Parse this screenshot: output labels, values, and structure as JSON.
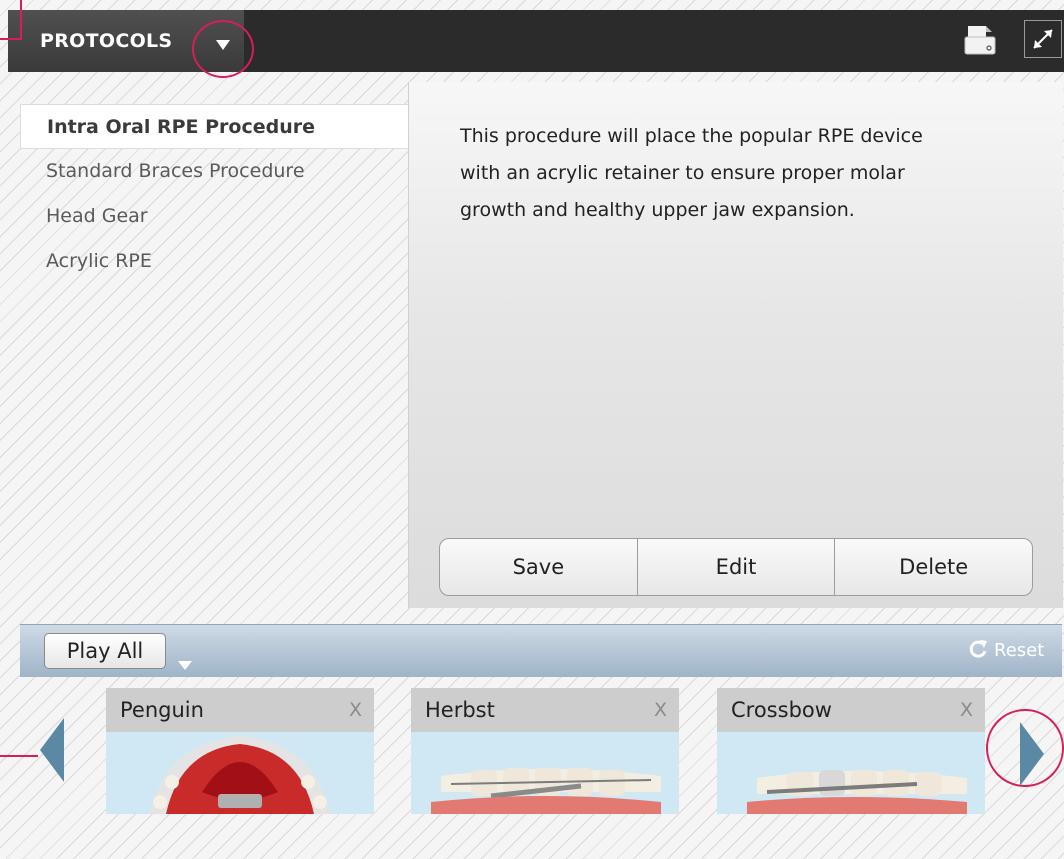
{
  "header": {
    "title": "PROTOCOLS",
    "dropdown_icon": "caret-down-icon",
    "print_icon": "print-icon",
    "expand_icon": "expand-icon"
  },
  "protocols": {
    "items": [
      {
        "label": "Intra Oral RPE Procedure",
        "selected": true
      },
      {
        "label": "Standard Braces Procedure",
        "selected": false
      },
      {
        "label": "Head Gear",
        "selected": false
      },
      {
        "label": "Acrylic RPE",
        "selected": false
      }
    ]
  },
  "description": {
    "line1": "This procedure will place the popular RPE device",
    "line2": "with an acrylic retainer to ensure proper molar",
    "line3": "growth and healthy upper jaw expansion."
  },
  "actions": {
    "save": "Save",
    "edit": "Edit",
    "delete": "Delete"
  },
  "playlist": {
    "play_all": "Play All",
    "reset": "Reset",
    "cards": [
      {
        "title": "Penguin",
        "close": "X"
      },
      {
        "title": "Herbst",
        "close": "X"
      },
      {
        "title": "Crossbow",
        "close": "X"
      }
    ]
  },
  "colors": {
    "highlight": "#d61f55",
    "nav_arrow": "#5b88a5",
    "topbar": "#2b2b2b"
  }
}
